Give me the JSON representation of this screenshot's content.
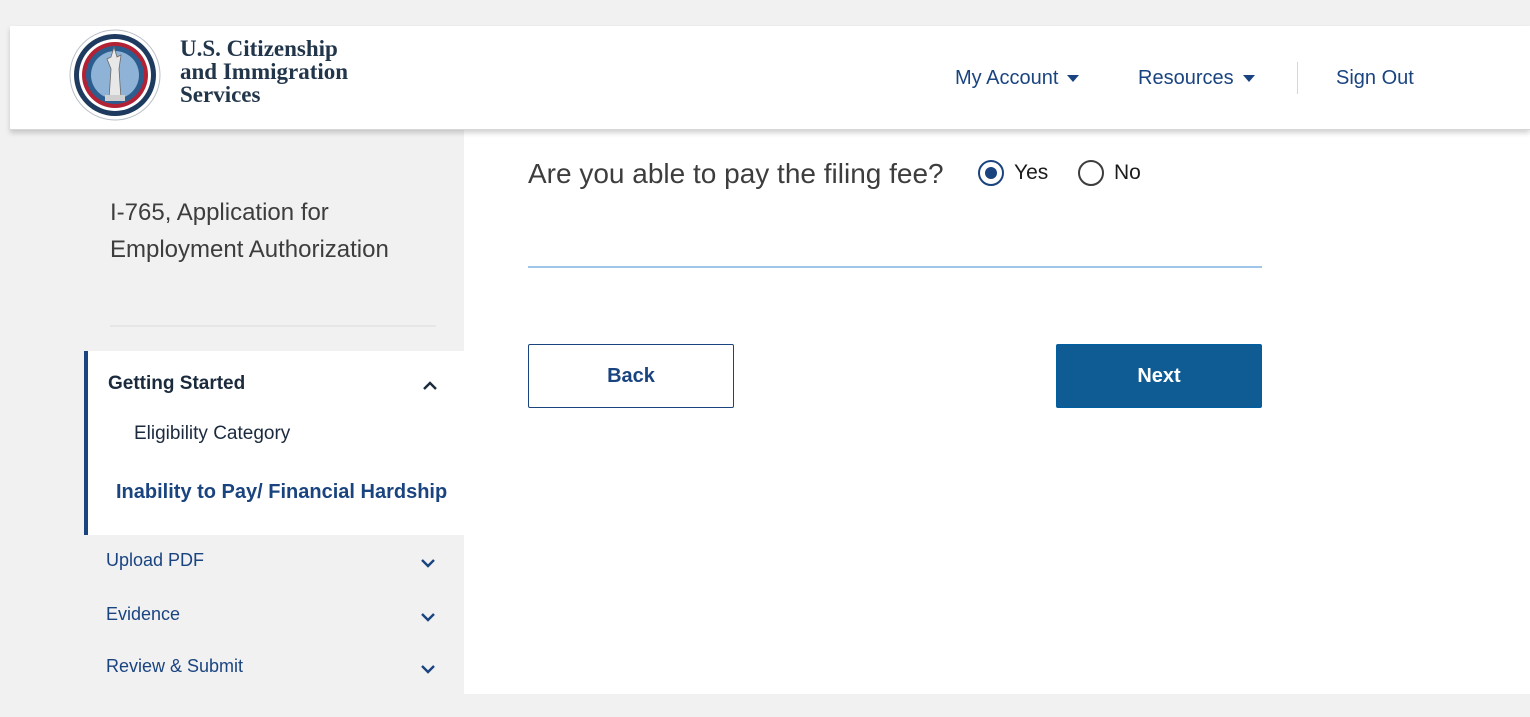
{
  "header": {
    "agency_lines": [
      "U.S. Citizenship",
      "and Immigration",
      "Services"
    ],
    "nav": {
      "my_account": "My Account",
      "resources": "Resources",
      "sign_out": "Sign Out"
    }
  },
  "sidebar": {
    "form_title": "I-765, Application for Employment Authorization",
    "sections": {
      "getting_started": {
        "label": "Getting Started",
        "items": [
          "Eligibility Category",
          "Inability to Pay/ Financial Hardship"
        ],
        "current_index": 1
      },
      "upload_pdf": "Upload PDF",
      "evidence": "Evidence",
      "review_submit": "Review & Submit"
    }
  },
  "main": {
    "question": "Are you able to pay the filing fee?",
    "options": {
      "yes": "Yes",
      "no": "No"
    },
    "selected": "yes",
    "back_label": "Back",
    "next_label": "Next"
  },
  "colors": {
    "brand_navy": "#1a4480",
    "primary_button": "#0f5b93",
    "sidebar_bg": "#f1f1f1"
  },
  "icons": {
    "seal": "dhs-uscis-seal",
    "dropdown": "caret-down-icon",
    "expand": "chevron-down-icon",
    "collapse": "chevron-up-icon"
  }
}
